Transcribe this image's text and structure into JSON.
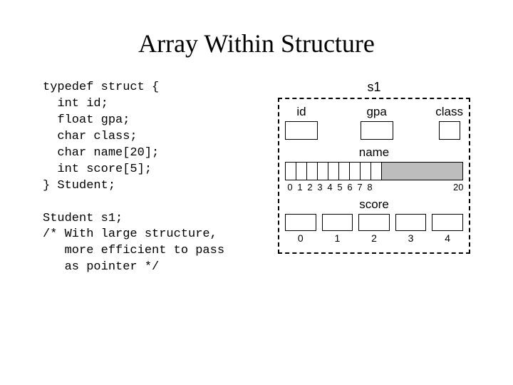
{
  "title": "Array Within Structure",
  "code": {
    "l1": "typedef struct {",
    "l2": "  int id;",
    "l3": "  float gpa;",
    "l4": "  char class;",
    "l5": "  char name[20];",
    "l6": "  int score[5];",
    "l7": "} Student;",
    "blank": "",
    "l8": "Student s1;",
    "l9": "/* With large structure,",
    "l10": "   more efficient to pass",
    "l11": "   as pointer */"
  },
  "diagram": {
    "var_label": "s1",
    "fields": {
      "id": "id",
      "gpa": "gpa",
      "class": "class"
    },
    "name_label": "name",
    "name_ticks": [
      "0",
      "1",
      "2",
      "3",
      "4",
      "5",
      "6",
      "7",
      "8"
    ],
    "name_last_tick": "20",
    "score_label": "score",
    "score_ticks": [
      "0",
      "1",
      "2",
      "3",
      "4"
    ]
  }
}
